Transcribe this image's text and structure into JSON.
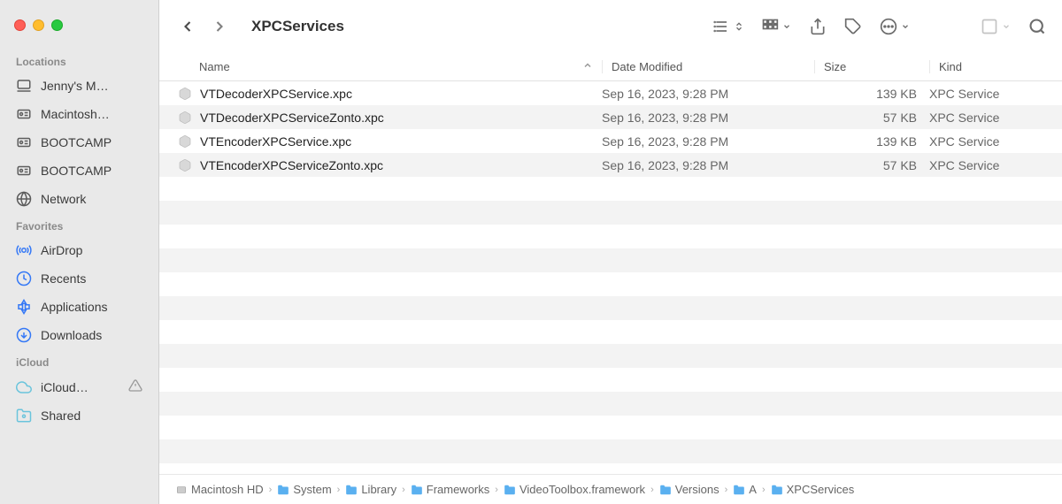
{
  "title": "XPCServices",
  "sidebar": {
    "sections": [
      {
        "title": "Locations",
        "items": [
          {
            "label": "Jenny's M…",
            "icon": "laptop"
          },
          {
            "label": "Macintosh…",
            "icon": "disk"
          },
          {
            "label": "BOOTCAMP",
            "icon": "disk"
          },
          {
            "label": "BOOTCAMP",
            "icon": "disk"
          },
          {
            "label": "Network",
            "icon": "globe"
          }
        ]
      },
      {
        "title": "Favorites",
        "items": [
          {
            "label": "AirDrop",
            "icon": "airdrop"
          },
          {
            "label": "Recents",
            "icon": "clock"
          },
          {
            "label": "Applications",
            "icon": "apps"
          },
          {
            "label": "Downloads",
            "icon": "download"
          }
        ]
      },
      {
        "title": "iCloud",
        "items": [
          {
            "label": "iCloud…",
            "icon": "cloud",
            "warn": true
          },
          {
            "label": "Shared",
            "icon": "shared"
          }
        ]
      }
    ]
  },
  "columns": {
    "name": "Name",
    "date": "Date Modified",
    "size": "Size",
    "kind": "Kind"
  },
  "files": [
    {
      "name": "VTDecoderXPCService.xpc",
      "date": "Sep 16, 2023, 9:28 PM",
      "size": "139 KB",
      "kind": "XPC Service"
    },
    {
      "name": "VTDecoderXPCServiceZonto.xpc",
      "date": "Sep 16, 2023, 9:28 PM",
      "size": "57 KB",
      "kind": "XPC Service"
    },
    {
      "name": "VTEncoderXPCService.xpc",
      "date": "Sep 16, 2023, 9:28 PM",
      "size": "139 KB",
      "kind": "XPC Service"
    },
    {
      "name": "VTEncoderXPCServiceZonto.xpc",
      "date": "Sep 16, 2023, 9:28 PM",
      "size": "57 KB",
      "kind": "XPC Service"
    }
  ],
  "path": [
    {
      "label": "Macintosh HD",
      "icon": "disk"
    },
    {
      "label": "System",
      "icon": "folder"
    },
    {
      "label": "Library",
      "icon": "folder"
    },
    {
      "label": "Frameworks",
      "icon": "folder"
    },
    {
      "label": "VideoToolbox.framework",
      "icon": "folder"
    },
    {
      "label": "Versions",
      "icon": "folder"
    },
    {
      "label": "A",
      "icon": "folder"
    },
    {
      "label": "XPCServices",
      "icon": "folder"
    }
  ]
}
